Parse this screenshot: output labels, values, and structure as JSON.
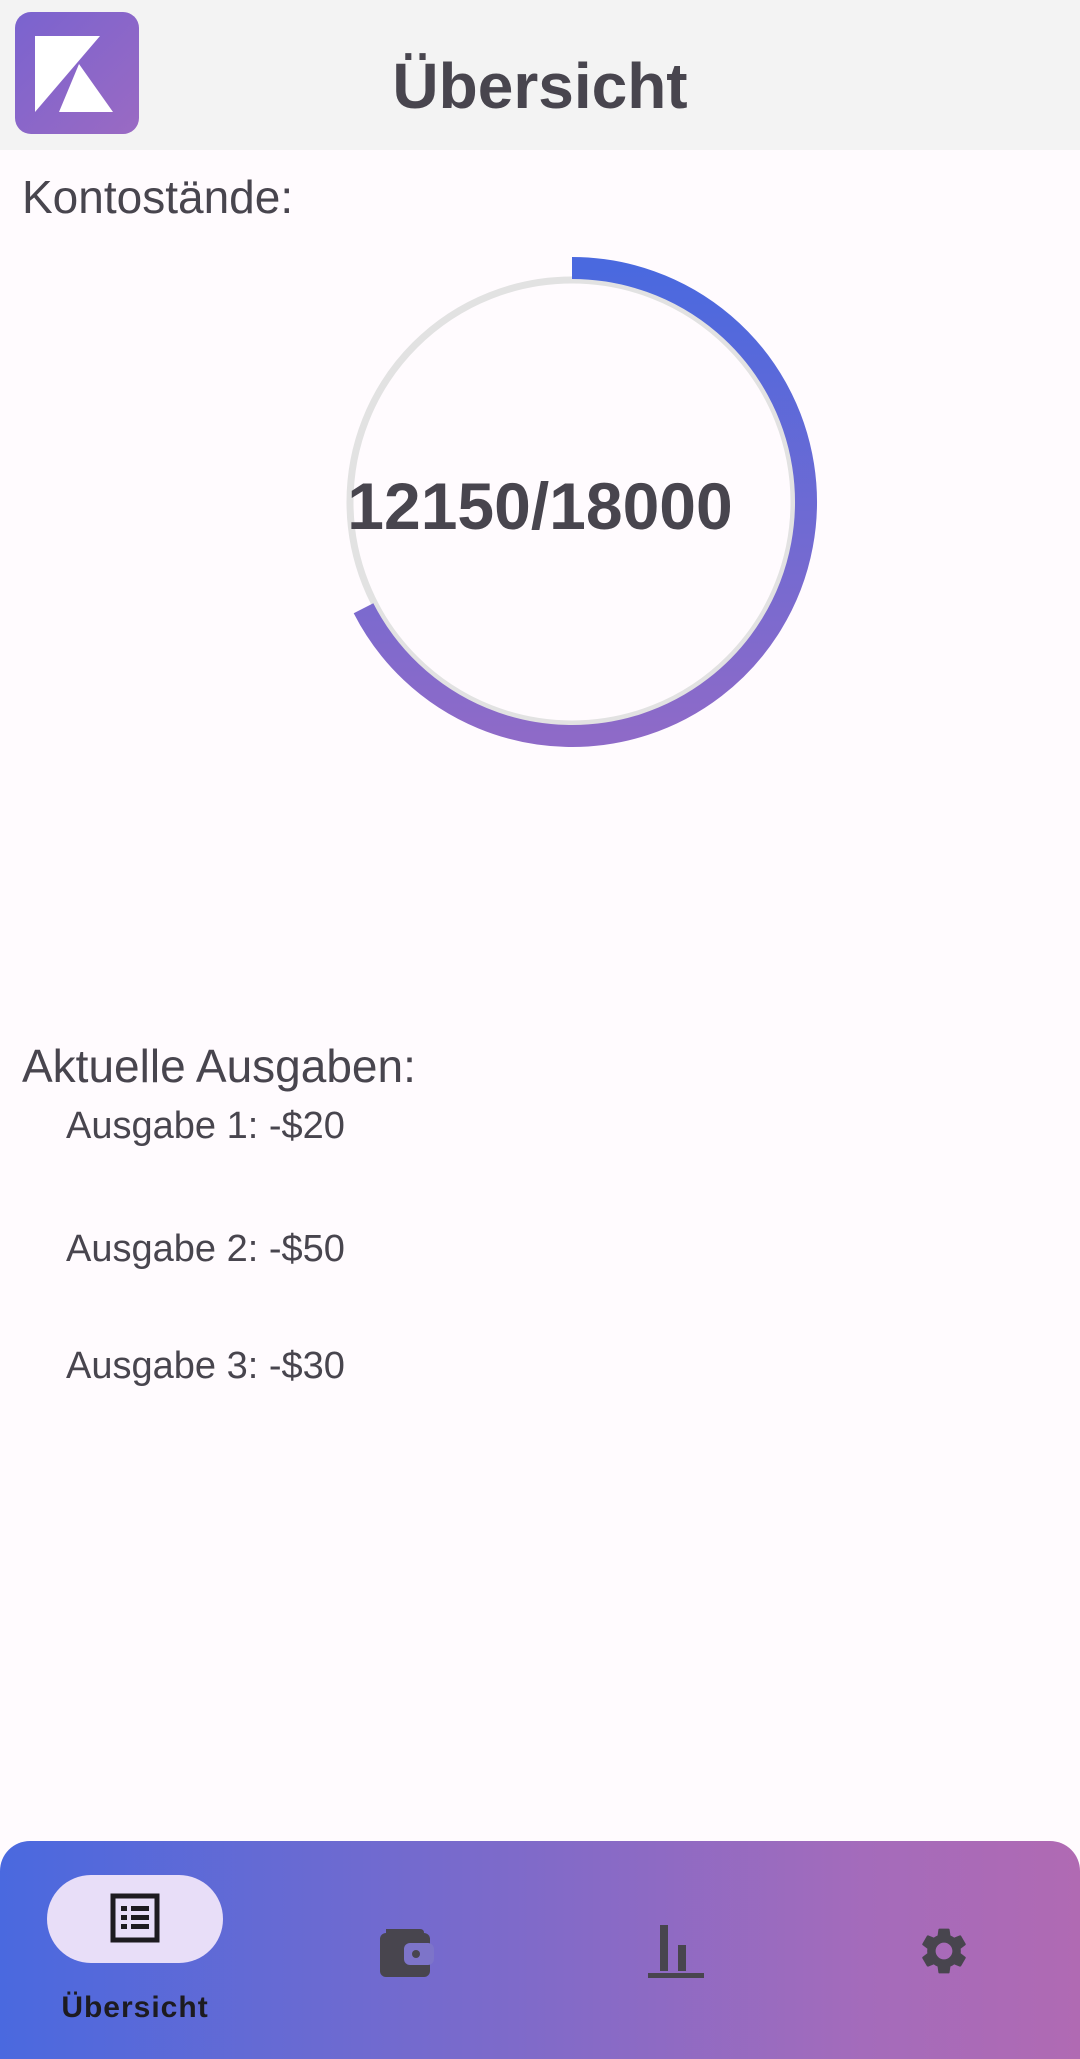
{
  "header": {
    "title": "Übersicht",
    "logo_icon": "k-logo-icon"
  },
  "balances": {
    "label": "Kontostände:",
    "current": 12150,
    "total": 18000,
    "display": "12150/18000",
    "progress_fraction": 0.675,
    "colors": {
      "start": "#4a69df",
      "end": "#8e6ac8",
      "track": "#e2e2e2"
    }
  },
  "expenses": {
    "label": "Aktuelle Ausgaben:",
    "items": [
      {
        "text": "Ausgabe 1: -$20"
      },
      {
        "text": "Ausgabe 2: -$50"
      },
      {
        "text": "Ausgabe 3: -$30"
      }
    ]
  },
  "nav": {
    "items": [
      {
        "icon": "list-icon",
        "label": "Übersicht",
        "active": true
      },
      {
        "icon": "wallet-icon",
        "label": "",
        "active": false
      },
      {
        "icon": "bar-chart-icon",
        "label": "",
        "active": false
      },
      {
        "icon": "gear-icon",
        "label": "",
        "active": false
      }
    ]
  }
}
